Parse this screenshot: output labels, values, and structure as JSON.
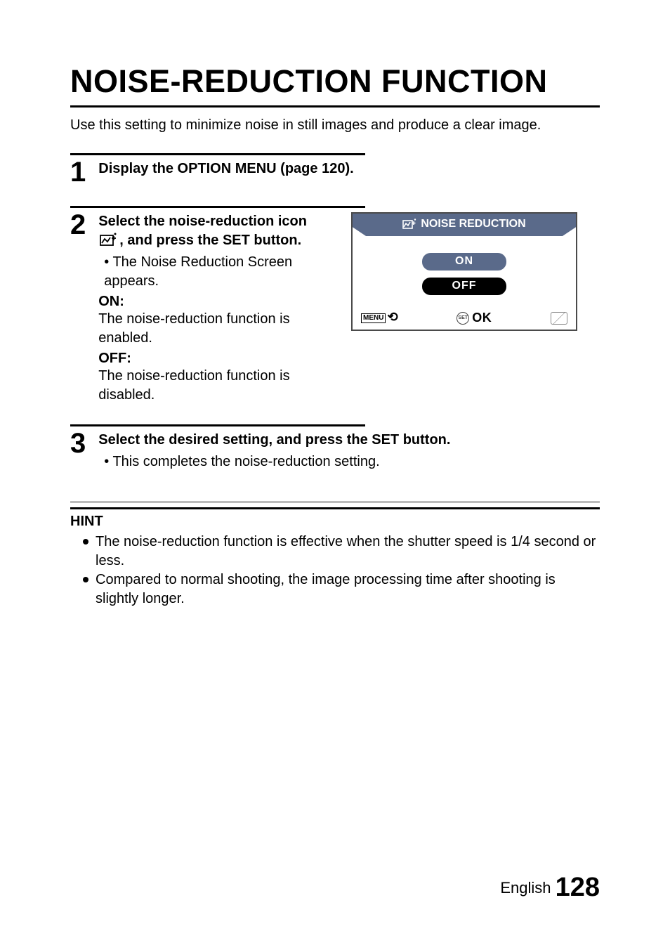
{
  "title": "NOISE-REDUCTION FUNCTION",
  "intro": "Use this setting to minimize noise in still images and produce a clear image.",
  "steps": {
    "s1": {
      "num": "1",
      "heading": "Display the OPTION MENU (page 120)."
    },
    "s2": {
      "num": "2",
      "heading_pre": "Select the noise-reduction icon ",
      "heading_post": ", and press the SET button.",
      "bullet": "The Noise Reduction Screen appears.",
      "on_label": "ON:",
      "on_desc": "The noise-reduction function is enabled.",
      "off_label": "OFF:",
      "off_desc": "The noise-reduction function is disabled."
    },
    "s3": {
      "num": "3",
      "heading": "Select the desired setting, and press the SET button.",
      "bullet": "This completes the noise-reduction setting."
    }
  },
  "screen": {
    "title": "NOISE REDUCTION",
    "on": "ON",
    "off": "OFF",
    "menu_label": "MENU",
    "set_label": "SET",
    "ok": "OK"
  },
  "hint": {
    "heading": "HINT",
    "items": [
      "The noise-reduction function is effective when the shutter speed is 1/4 second or less.",
      "Compared to normal shooting, the image processing time after shooting is slightly longer."
    ]
  },
  "footer": {
    "lang": "English",
    "page": "128"
  }
}
